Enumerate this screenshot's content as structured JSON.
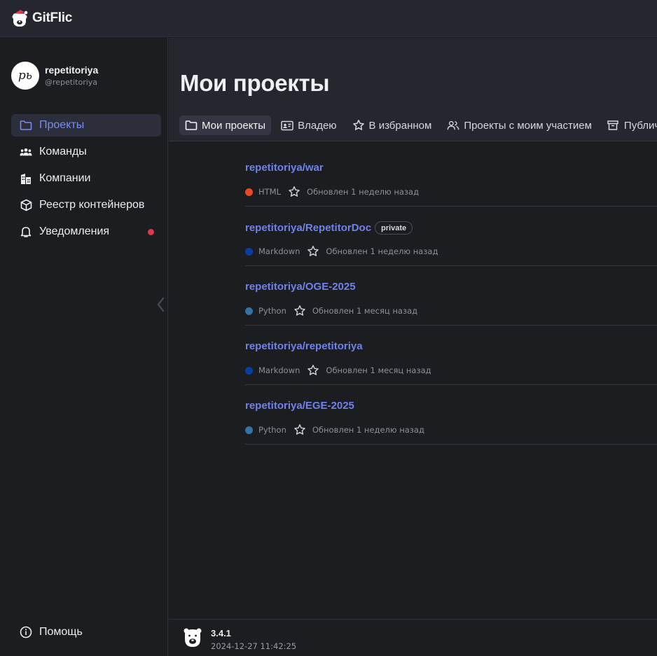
{
  "app": {
    "name": "GitFlic"
  },
  "user": {
    "name": "repetitoriya",
    "handle": "@repetitoriya",
    "avatar_text": "рь"
  },
  "sidebar": {
    "items": [
      {
        "label": "Проекты",
        "icon": "folder-icon",
        "active": true
      },
      {
        "label": "Команды",
        "icon": "team-icon"
      },
      {
        "label": "Компании",
        "icon": "building-icon"
      },
      {
        "label": "Реестр контейнеров",
        "icon": "cube-icon"
      },
      {
        "label": "Уведомления",
        "icon": "bell-icon",
        "has_notification": true
      }
    ],
    "help_label": "Помощь"
  },
  "main": {
    "title": "Мои проекты",
    "tabs": [
      {
        "label": "Мои проекты",
        "icon": "folder-icon",
        "active": true
      },
      {
        "label": "Владею",
        "icon": "id-card-icon"
      },
      {
        "label": "В избранном",
        "icon": "star-icon"
      },
      {
        "label": "Проекты с моим участием",
        "icon": "people-icon"
      },
      {
        "label": "Публич",
        "icon": "archive-icon"
      }
    ],
    "repos": [
      {
        "name": "repetitoriya/war",
        "language": "HTML",
        "lang_color": "#e34c26",
        "updated": "Обновлен 1 неделю назад"
      },
      {
        "name": "repetitoriya/RepetitorDoc",
        "badge": "private",
        "language": "Markdown",
        "lang_color": "#083fa1",
        "updated": "Обновлен 1 неделю назад"
      },
      {
        "name": "repetitoriya/OGE-2025",
        "language": "Python",
        "lang_color": "#3572a5",
        "updated": "Обновлен 1 месяц назад"
      },
      {
        "name": "repetitoriya/repetitoriya",
        "language": "Markdown",
        "lang_color": "#083fa1",
        "updated": "Обновлен 1 месяц назад"
      },
      {
        "name": "repetitoriya/EGE-2025",
        "language": "Python",
        "lang_color": "#3572a5",
        "updated": "Обновлен 1 неделю назад"
      }
    ]
  },
  "footer": {
    "version": "3.4.1",
    "build_date": "2024-12-27 11:42:25"
  },
  "colors": {
    "accent": "#7082e8",
    "notification": "#e0394b",
    "sidebar_bg": "#1b1d21",
    "header_bg": "#25272e"
  }
}
